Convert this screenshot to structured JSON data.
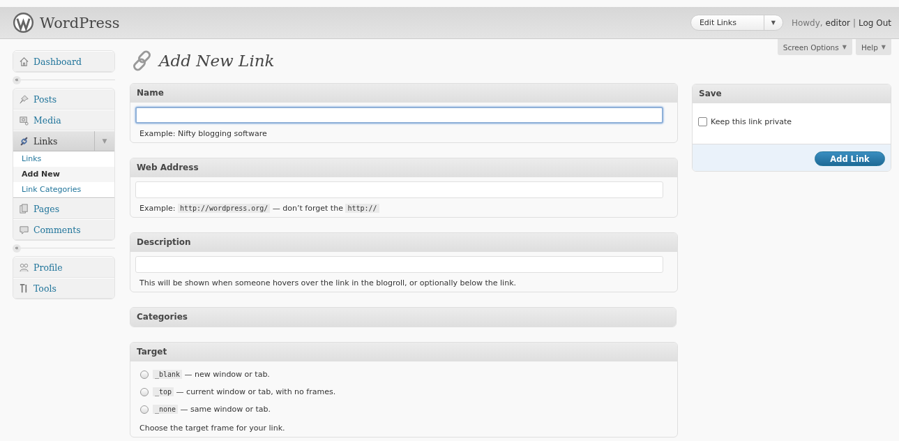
{
  "header": {
    "site_title": "WordPress",
    "favorite_actions": {
      "label": "Edit Links",
      "toggle": "▼"
    },
    "greeting": "Howdy,",
    "user": "editor",
    "separator": "|",
    "logout": "Log Out"
  },
  "screen_meta": [
    {
      "label": "Screen Options",
      "toggle": "▼"
    },
    {
      "label": "Help",
      "toggle": "▼"
    }
  ],
  "sidebar": {
    "collapse_arrow": "«",
    "groups": [
      [
        {
          "label": "Dashboard",
          "selected": false
        }
      ],
      [
        {
          "label": "Posts",
          "selected": false
        },
        {
          "label": "Media",
          "selected": false
        },
        {
          "label": "Links",
          "selected": true,
          "expanded": true,
          "toggle": "▼",
          "children": [
            {
              "label": "Links",
              "selected": false
            },
            {
              "label": "Add New",
              "selected": true
            },
            {
              "label": "Link Categories",
              "selected": false
            }
          ]
        },
        {
          "label": "Pages",
          "selected": false
        },
        {
          "label": "Comments",
          "selected": false
        }
      ],
      [
        {
          "label": "Profile",
          "selected": false
        },
        {
          "label": "Tools",
          "selected": false
        }
      ]
    ]
  },
  "page_title": "Add New Link",
  "boxes": [
    {
      "kind": "field",
      "title": "Name",
      "focused": true,
      "hint": [
        {
          "kind": "text",
          "text": "Example: Nifty blogging software"
        }
      ]
    },
    {
      "kind": "field",
      "title": "Web Address",
      "focused": false,
      "hint": [
        {
          "kind": "text",
          "text": "Example: "
        },
        {
          "kind": "code",
          "text": "http://wordpress.org/"
        },
        {
          "kind": "text",
          "text": " — don’t forget the "
        },
        {
          "kind": "code",
          "text": "http://"
        }
      ]
    },
    {
      "kind": "field",
      "title": "Description",
      "focused": false,
      "hint": [
        {
          "kind": "text",
          "text": "This will be shown when someone hovers over the link in the blogroll, or optionally below the link."
        }
      ]
    },
    {
      "kind": "closed",
      "title": "Categories"
    },
    {
      "kind": "radios",
      "title": "Target",
      "options": [
        {
          "code": "_blank",
          "text": "— new window or tab.",
          "selected": false
        },
        {
          "code": "_top",
          "text": "— current window or tab, with no frames.",
          "selected": false
        },
        {
          "code": "_none",
          "text": "— same window or tab.",
          "selected": false
        }
      ],
      "note": "Choose the target frame for your link."
    }
  ],
  "save_box": {
    "title": "Save",
    "private": {
      "label": "Keep this link private",
      "checked": false
    },
    "button": "Add Link"
  }
}
